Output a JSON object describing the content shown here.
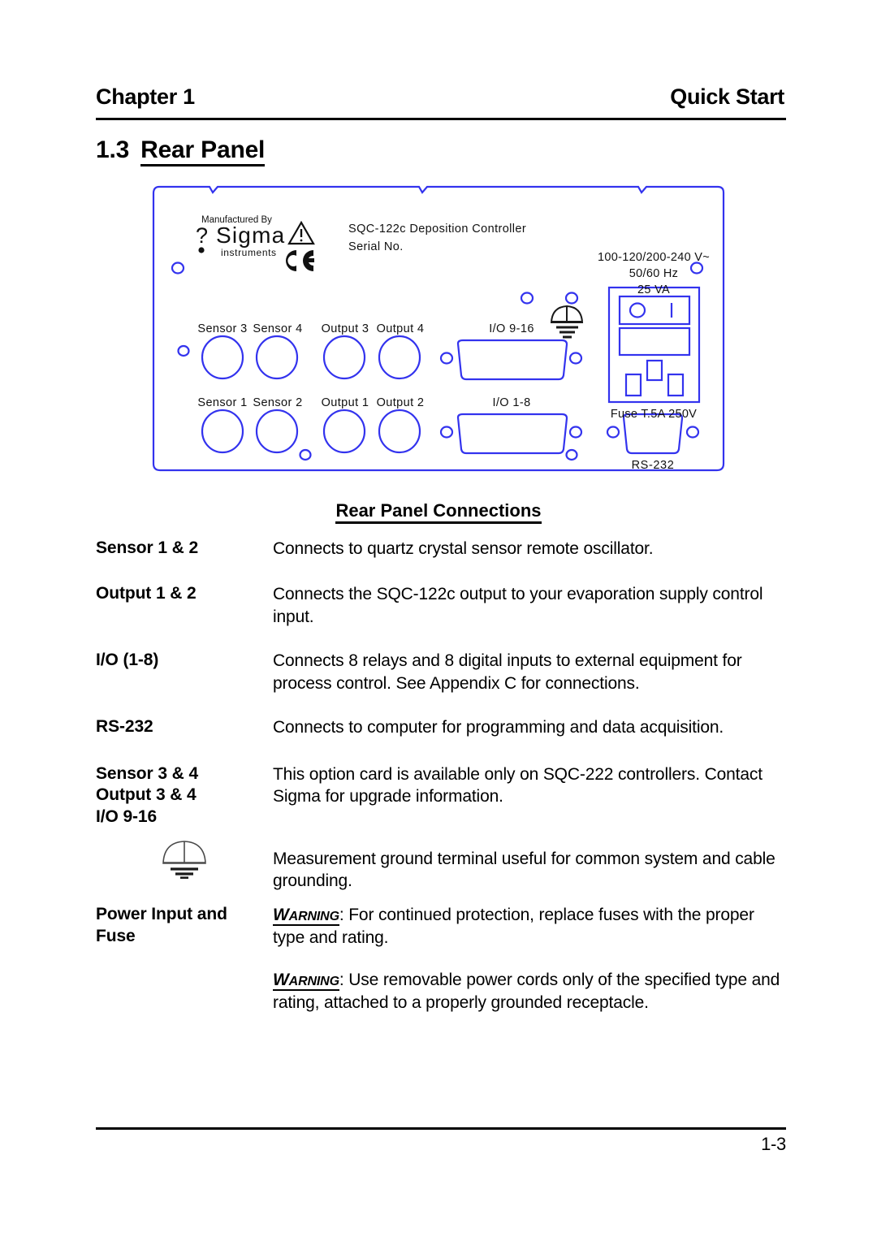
{
  "header": {
    "chapter": "Chapter 1",
    "running_title": "Quick Start"
  },
  "section": {
    "number": "1.3",
    "title": "Rear Panel"
  },
  "panel_diagram": {
    "manufactured_by": "Manufactured By",
    "brand": "Sigma",
    "brand_sub": "instruments",
    "warning_symbol": "!",
    "ce_mark": "CE",
    "model_line": "SQC-122c Deposition Controller",
    "serial_line": "Serial No.",
    "power_rating_line1": "100-120/200-240 V~",
    "power_rating_line2": "50/60 Hz",
    "power_rating_line3": "25 VA",
    "fuse_label": "Fuse T.5A 250V",
    "switch_off": "O",
    "switch_on": "I",
    "connector_labels": {
      "top_row": [
        "Sensor 3",
        "Sensor 4",
        "Output 3",
        "Output 4"
      ],
      "bottom_row": [
        "Sensor 1",
        "Sensor 2",
        "Output 1",
        "Output 2"
      ],
      "io_top": "I/O 9-16",
      "io_bottom": "I/O 1-8",
      "serial": "RS-232"
    }
  },
  "connections": {
    "title": "Rear Panel Connections",
    "rows": [
      {
        "term": "Sensor 1 & 2",
        "desc": "Connects to quartz crystal sensor remote oscillator."
      },
      {
        "term": "Output 1 & 2",
        "desc": "Connects the SQC-122c output to your evaporation supply control input."
      },
      {
        "term": "I/O (1-8)",
        "desc": "Connects 8 relays and 8 digital inputs to external equipment for process control.  See Appendix C for connections."
      },
      {
        "term": "RS-232",
        "desc": "Connects to computer for programming and data acquisition."
      },
      {
        "term_line1": "Sensor 3 & 4",
        "term_line2": "Output 3 & 4",
        "term_line3": "I/O 9-16",
        "desc": "This option card is available only on SQC-222 controllers. Contact Sigma for upgrade information."
      },
      {
        "term": "ground-symbol",
        "desc": "Measurement ground terminal useful for common system and cable grounding."
      },
      {
        "term_line1": "Power Input and",
        "term_line2": "Fuse",
        "warning_label": "W",
        "warning_rest": "ARNING",
        "desc1": ": For continued protection, replace fuses with the proper type and rating.",
        "desc2": ": Use removable power cords only of the specified type and rating, attached to a properly grounded receptacle."
      }
    ]
  },
  "footer": {
    "page_number": "1-3"
  },
  "colors": {
    "panel_line": "#3333ee",
    "text": "#000000",
    "background": "#ffffff"
  }
}
